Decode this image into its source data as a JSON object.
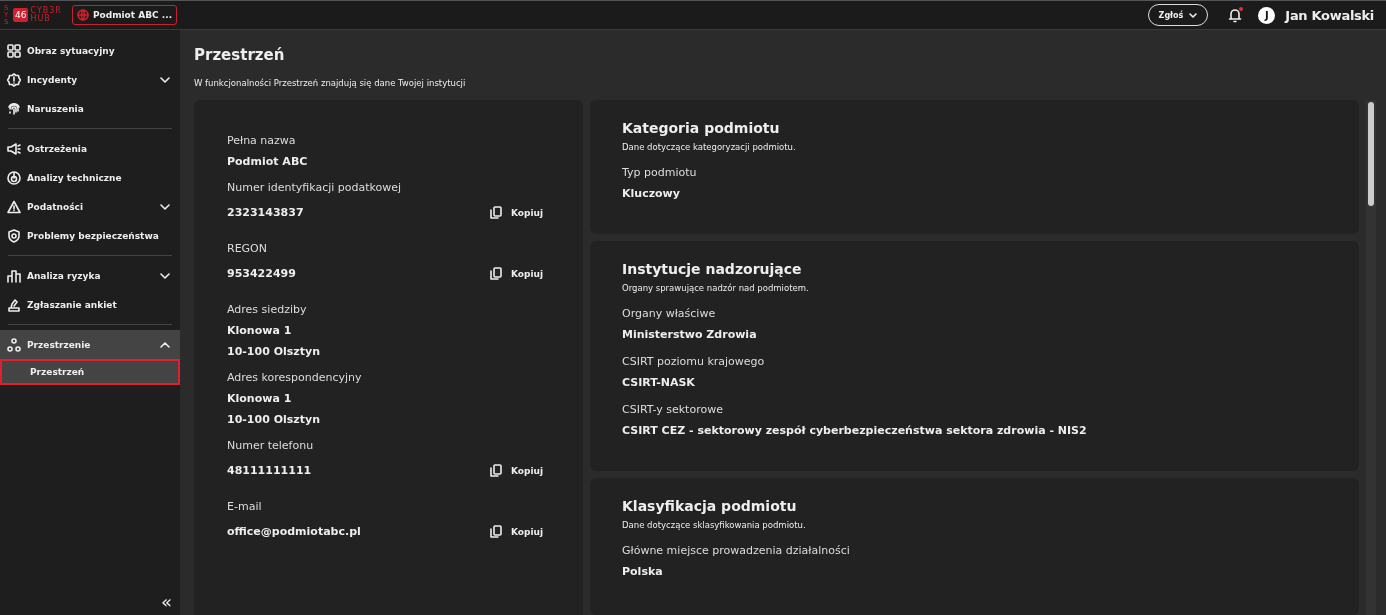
{
  "topbar": {
    "logo": {
      "prefix": "SYS",
      "number": "46",
      "line1": "CYB3R",
      "line2": "HUB"
    },
    "entity": "Podmiot ABC ...",
    "report_button": "Zgłoś",
    "notifications": {
      "unread": true
    },
    "user": {
      "initial": "J",
      "name": "Jan Kowalski"
    }
  },
  "sidebar": {
    "groups": [
      {
        "items": [
          {
            "label": "Obraz sytuacyjny",
            "selected": false
          },
          {
            "label": "Incydenty",
            "selected": false,
            "expanded": false
          },
          {
            "label": "Naruszenia",
            "selected": false
          }
        ]
      },
      {
        "items": [
          {
            "label": "Ostrzeżenia",
            "selected": false
          },
          {
            "label": "Analizy techniczne",
            "selected": false
          },
          {
            "label": "Podatności",
            "selected": false,
            "expanded": false
          },
          {
            "label": "Problemy bezpieczeństwa",
            "selected": false
          }
        ]
      },
      {
        "items": [
          {
            "label": "Analiza ryzyka",
            "selected": false,
            "expanded": false
          },
          {
            "label": "Zgłaszanie ankiet",
            "selected": false
          }
        ]
      },
      {
        "items": [
          {
            "label": "Przestrzenie",
            "selected": true,
            "expanded": true,
            "children": [
              {
                "label": "Przestrzeń",
                "selected": true
              }
            ]
          }
        ]
      }
    ],
    "collapse": "«"
  },
  "page": {
    "title": "Przestrzeń",
    "subtitle": "W funkcjonalności Przestrzeń znajdują się dane Twojej instytucji"
  },
  "details": [
    {
      "label": "Pełna nazwa",
      "values": [
        "Podmiot ABC"
      ]
    },
    {
      "label": "Numer identyfikacji podatkowej",
      "values": [
        "2323143837"
      ],
      "copy": "Kopiuj"
    },
    {
      "label": "REGON",
      "values": [
        "953422499"
      ],
      "copy": "Kopiuj"
    },
    {
      "label": "Adres siedziby",
      "values": [
        "Klonowa 1",
        "10-100 Olsztyn"
      ]
    },
    {
      "label": "Adres korespondencyjny",
      "values": [
        "Klonowa 1",
        "10-100 Olsztyn"
      ]
    },
    {
      "label": "Numer telefonu",
      "values": [
        "48111111111"
      ],
      "copy": "Kopiuj"
    },
    {
      "label": "E-mail",
      "values": [
        "office@podmiotabc.pl"
      ],
      "copy": "Kopiuj"
    }
  ],
  "cards": [
    {
      "title": "Kategoria podmiotu",
      "subtitle": "Dane dotyczące kategoryzacji podmiotu.",
      "fields": [
        {
          "label": "Typ podmiotu",
          "value": "Kluczowy"
        }
      ]
    },
    {
      "title": "Instytucje nadzorujące",
      "subtitle": "Organy sprawujące nadzór nad podmiotem.",
      "fields": [
        {
          "label": "Organy właściwe",
          "value": "Ministerstwo Zdrowia"
        },
        {
          "label": "CSIRT poziomu krajowego",
          "value": "CSIRT-NASK"
        },
        {
          "label": "CSIRT-y sektorowe",
          "value": "CSIRT CEZ - sektorowy zespół cyberbezpieczeństwa sektora zdrowia - NIS2"
        }
      ]
    },
    {
      "title": "Klasyfikacja podmiotu",
      "subtitle": "Dane dotyczące sklasyfikowania podmiotu.",
      "fields": [
        {
          "label": "Główne miejsce prowadzenia działalności",
          "value": "Polska"
        }
      ]
    }
  ]
}
